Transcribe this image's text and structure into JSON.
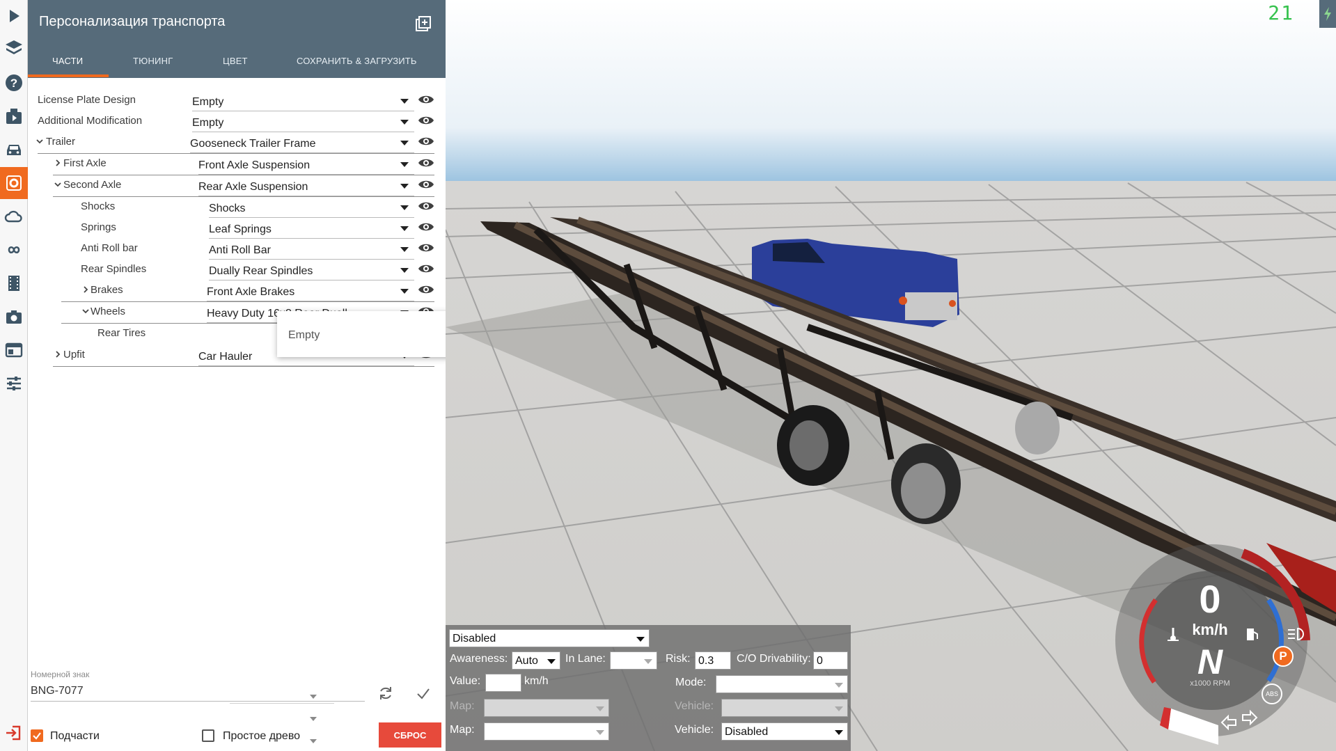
{
  "panel": {
    "title": "Персонализация транспорта",
    "tabs": [
      {
        "label": "ЧАСТИ",
        "active": true
      },
      {
        "label": "ТЮНИНГ",
        "active": false
      },
      {
        "label": "ЦВЕТ",
        "active": false
      },
      {
        "label": "СОХРАНИТЬ & ЗАГРУЗИТЬ",
        "active": false
      }
    ]
  },
  "parts": [
    {
      "label": "License Plate Design",
      "value": "Empty"
    },
    {
      "label": "Additional Modification",
      "value": "Empty"
    },
    {
      "label": "Trailer",
      "value": "Gooseneck Trailer Frame",
      "expander": "expanded"
    },
    {
      "label": "First Axle",
      "value": "Front Axle Suspension",
      "expander": "collapsed"
    },
    {
      "label": "Second Axle",
      "value": "Rear Axle Suspension",
      "expander": "expanded"
    },
    {
      "label": "Shocks",
      "value": "Shocks"
    },
    {
      "label": "Springs",
      "value": "Leaf Springs"
    },
    {
      "label": "Anti Roll bar",
      "value": "Anti Roll Bar"
    },
    {
      "label": "Rear Spindles",
      "value": "Dually Rear Spindles"
    },
    {
      "label": "Brakes",
      "value": "Front Axle Brakes",
      "expander": "collapsed"
    },
    {
      "label": "Wheels",
      "value": "Heavy Duty 16x8 Rear Duall",
      "expander": "expanded"
    },
    {
      "label": "Rear Tires",
      "value": ""
    },
    {
      "label": "Upfit",
      "value": "Car Hauler",
      "expander": "collapsed"
    }
  ],
  "dropdown": {
    "open_option": "Empty"
  },
  "plate": {
    "label": "Номерной знак",
    "value": "BNG-7077"
  },
  "footer": {
    "subparts_label": "Подчасти",
    "subparts_checked": true,
    "simple_tree_label": "Простое древо",
    "simple_tree_checked": false,
    "reset_label": "СБРОС"
  },
  "fps": "21",
  "ai": {
    "mode_value": "Disabled",
    "awareness_label": "Awareness:",
    "awareness_value": "Auto",
    "in_lane_label": "In Lane:",
    "in_lane_value": "",
    "risk_label": "Risk:",
    "risk_value": "0.3",
    "drivability_label": "C/O Drivability:",
    "drivability_value": "0",
    "value_label": "Value:",
    "value_value": "",
    "value_unit": "km/h",
    "mode_label": "Mode:",
    "mode2_value": "",
    "map1_label": "Map:",
    "map1_value": "",
    "vehicle1_label": "Vehicle:",
    "vehicle1_value": "",
    "map2_label": "Map:",
    "map2_value": "",
    "vehicle2_label": "Vehicle:",
    "vehicle2_value": "Disabled"
  },
  "hud": {
    "speed": "0",
    "speed_unit": "km/h",
    "gear": "N",
    "rpm_unit": "x1000 RPM",
    "parking_brake": "P",
    "abs": "ABS"
  },
  "colors": {
    "header": "#566b7a",
    "accent": "#f06a1f",
    "reset": "#e74a3b",
    "fps": "#35c24d",
    "truck": "#2b3f9a",
    "sky": "#bcd6ea"
  }
}
